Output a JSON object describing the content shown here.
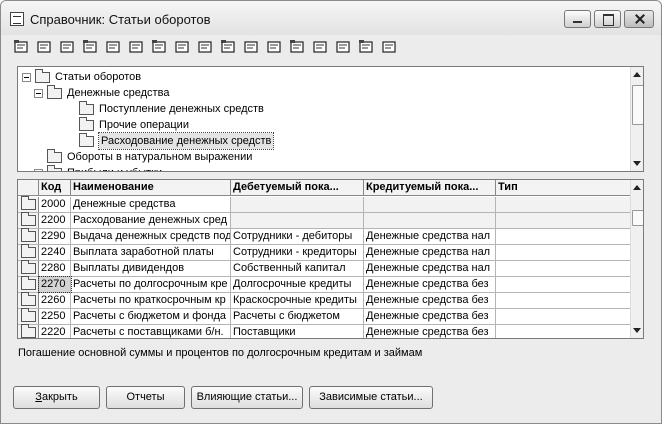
{
  "window": {
    "title": "Справочник: Статьи оборотов"
  },
  "toolbar": {
    "icons": [
      "new-item-icon",
      "new-group-icon",
      "copy-icon",
      "find-icon",
      "edit-icon",
      "delete-icon",
      "move-icon",
      "move-to-group-icon",
      "filter-icon",
      "hierarchy-icon",
      "cut-icon",
      "paste-icon",
      "document-icon",
      "print-icon",
      "tree-view-icon",
      "help-icon",
      "context-help-icon"
    ]
  },
  "tree": {
    "nodes": [
      {
        "label": "Статьи оборотов",
        "level": 0,
        "expander": true
      },
      {
        "label": "Денежные средства",
        "level": 1,
        "expander": true
      },
      {
        "label": "Поступление денежных средств",
        "level": 2,
        "expander": false
      },
      {
        "label": "Прочие операции",
        "level": 2,
        "expander": false
      },
      {
        "label": "Расходование денежных средств",
        "level": 2,
        "expander": false,
        "selected": true
      },
      {
        "label": "Обороты в натуральном выражении",
        "level": 1,
        "expander": false
      },
      {
        "label": "Прибыли и убытки",
        "level": 1,
        "expander": true
      }
    ]
  },
  "table": {
    "columns": [
      "Код",
      "Наименование",
      "Дебетуемый пока...",
      "Кредитуемый пока...",
      "Тип"
    ],
    "rows": [
      {
        "code": "2000",
        "name": "Денежные средства",
        "debit": "",
        "credit": "",
        "type": "",
        "group": true
      },
      {
        "code": "2200",
        "name": "Расходование денежных сред",
        "debit": "",
        "credit": "",
        "type": "",
        "group": true
      },
      {
        "code": "2290",
        "name": "Выдача денежных средств под",
        "debit": "Сотрудники - дебиторы",
        "credit": "Денежные средства нал",
        "type": ""
      },
      {
        "code": "2240",
        "name": "Выплата заработной платы",
        "debit": "Сотрудники - кредиторы",
        "credit": "Денежные средства нал",
        "type": ""
      },
      {
        "code": "2280",
        "name": "Выплаты дивидендов",
        "debit": "Собственный капитал",
        "credit": "Денежные средства нал",
        "type": ""
      },
      {
        "code": "2270",
        "name": "Расчеты по долгосрочным кре",
        "debit": "Долгосрочные кредиты",
        "credit": "Денежные средства без",
        "type": "",
        "current": true
      },
      {
        "code": "2260",
        "name": "Расчеты по краткосрочным кр",
        "debit": "Краскосрочные кредиты",
        "credit": "Денежные средства без",
        "type": ""
      },
      {
        "code": "2250",
        "name": "Расчеты с бюджетом и фонда",
        "debit": "Расчеты с бюджетом",
        "credit": "Денежные средства без",
        "type": ""
      },
      {
        "code": "2220",
        "name": "Расчеты с поставщиками б/н.",
        "debit": "Поставщики",
        "credit": "Денежные средства без",
        "type": ""
      }
    ]
  },
  "status": {
    "text": "Погашение основной суммы и процентов по долгосрочным кредитам и займам"
  },
  "buttons": {
    "close": "Закрыть",
    "reports": "Отчеты",
    "influencing": "Влияющие статьи...",
    "dependent": "Зависимые статьи..."
  }
}
